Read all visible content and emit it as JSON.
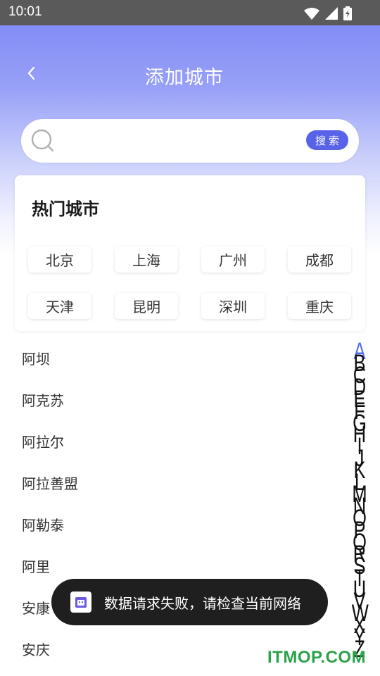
{
  "statusbar": {
    "time": "10:01",
    "icons": [
      "wifi-icon",
      "cell-signal-icon",
      "battery-charging-icon"
    ]
  },
  "header": {
    "title": "添加城市",
    "back_icon": "chevron-left-icon"
  },
  "search": {
    "placeholder": "",
    "value": "",
    "button_label": "搜索"
  },
  "hot_cities": {
    "title": "热门城市",
    "cities": [
      "北京",
      "上海",
      "广州",
      "成都",
      "天津",
      "昆明",
      "深圳",
      "重庆"
    ]
  },
  "city_list": [
    "阿坝",
    "阿克苏",
    "阿拉尔",
    "阿拉善盟",
    "阿勒泰",
    "阿里",
    "安康",
    "安庆"
  ],
  "index_bar": {
    "active": "A",
    "letters": [
      "A",
      "B",
      "C",
      "D",
      "E",
      "F",
      "G",
      "H",
      "I",
      "J",
      "K",
      "L",
      "M",
      "N",
      "O",
      "P",
      "Q",
      "R",
      "S",
      "T",
      "U",
      "V",
      "W",
      "X",
      "Y",
      "Z"
    ]
  },
  "toast": {
    "message": "数据请求失败，请检查当前网络",
    "icon": "app-icon"
  },
  "watermark": {
    "text": "ITMOP.COM"
  },
  "colors": {
    "accent": "#5863e8",
    "index_active": "#4f6ef0",
    "gradient_top": "#7a86f5",
    "watermark": "#2ba24a"
  }
}
